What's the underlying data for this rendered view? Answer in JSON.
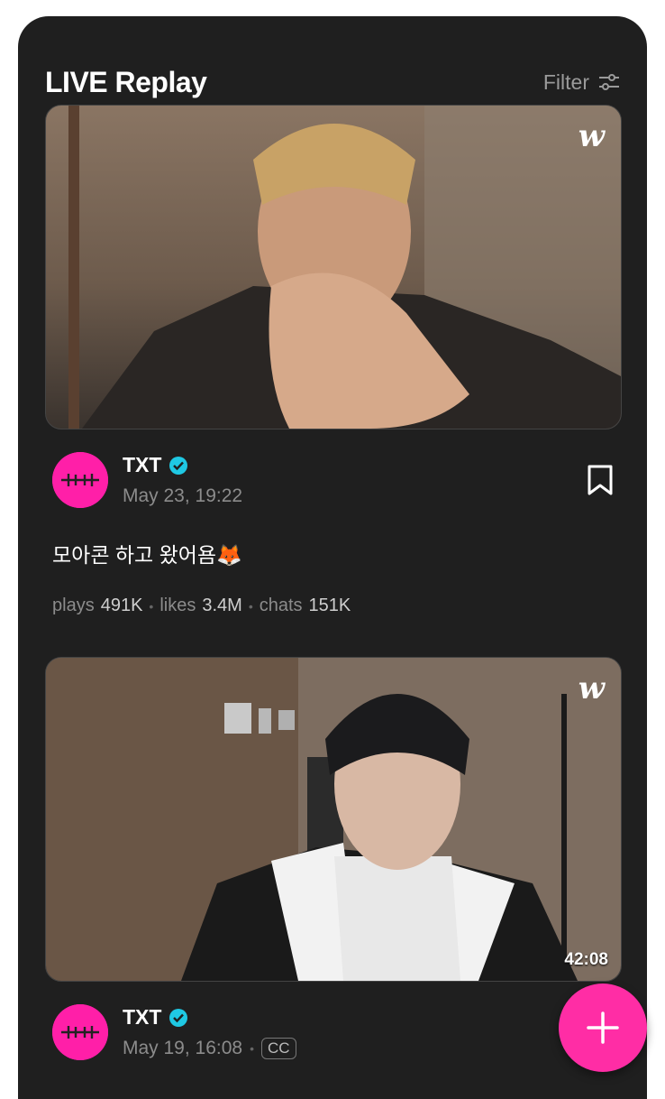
{
  "header": {
    "title": "LIVE Replay",
    "filter_label": "Filter"
  },
  "posts": [
    {
      "channel": "TXT",
      "date": "May 23, 19:22",
      "title": "모아콘 하고 왔어욤🦊",
      "stats": {
        "plays_label": "plays",
        "plays": "491K",
        "likes_label": "likes",
        "likes": "3.4M",
        "chats_label": "chats",
        "chats": "151K"
      }
    },
    {
      "channel": "TXT",
      "date": "May 19, 16:08",
      "cc": "CC",
      "duration": "42:08"
    }
  ],
  "watermark": "w",
  "colors": {
    "background": "#1f1f1f",
    "accent": "#ff2da5",
    "verified": "#1fc8e3"
  }
}
